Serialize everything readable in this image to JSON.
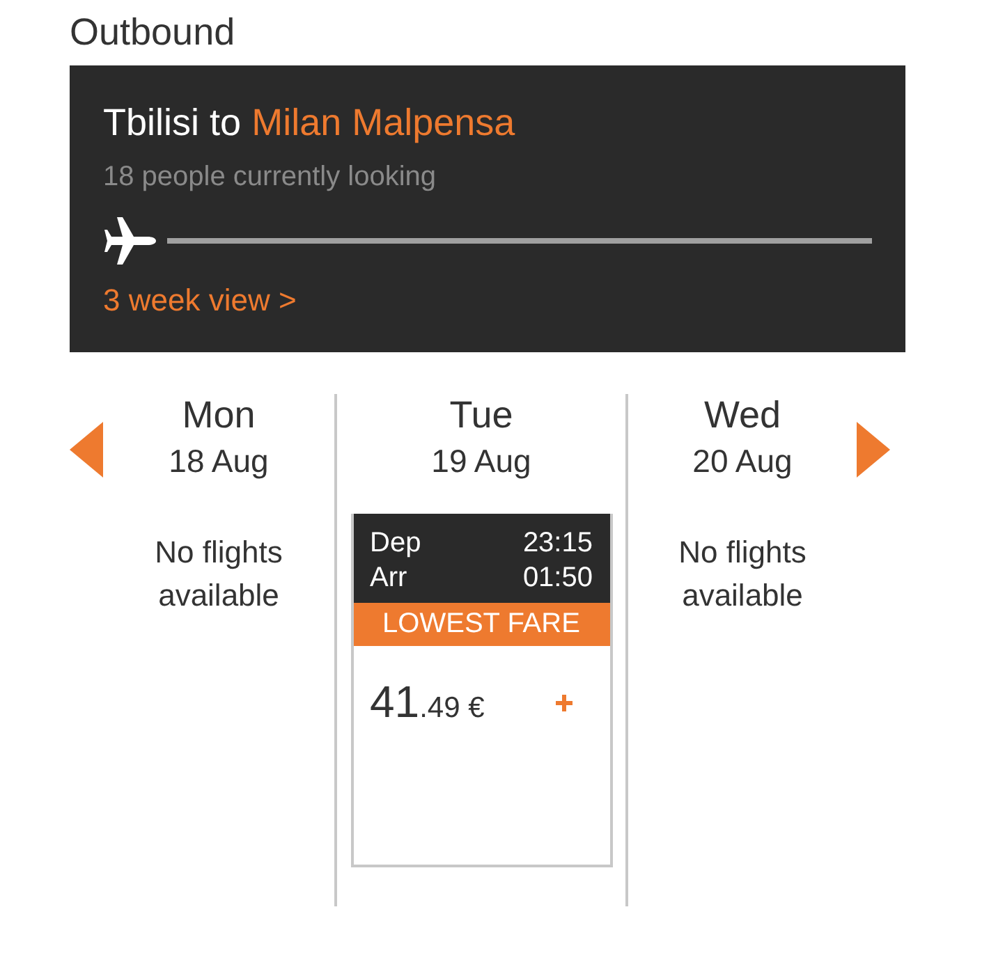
{
  "heading": "Outbound",
  "route": {
    "origin": "Tbilisi",
    "connector": "to",
    "destination": "Milan Malpensa",
    "viewers": "18 people currently looking",
    "link": "3 week view >"
  },
  "days": [
    {
      "weekday": "Mon",
      "date": "18 Aug",
      "kind": "empty",
      "message": "No flights available"
    },
    {
      "weekday": "Tue",
      "date": "19 Aug",
      "kind": "flight",
      "dep_label": "Dep",
      "dep_time": "23:15",
      "arr_label": "Arr",
      "arr_time": "01:50",
      "badge": "LOWEST FARE",
      "price_main": "41",
      "price_rest": ".49 €"
    },
    {
      "weekday": "Wed",
      "date": "20 Aug",
      "kind": "empty",
      "message": "No flights available"
    }
  ]
}
